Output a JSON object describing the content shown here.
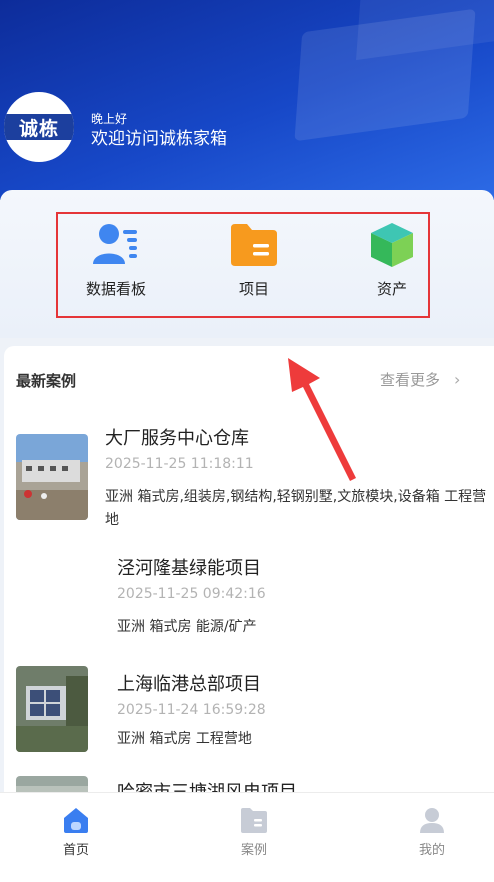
{
  "header": {
    "greeting": "晚上好",
    "welcome": "欢迎访问诚栋家箱",
    "logo_text": "诚栋"
  },
  "quick_actions": [
    {
      "label": "数据看板",
      "icon": "dashboard-user-list-icon"
    },
    {
      "label": "项目",
      "icon": "folder-icon"
    },
    {
      "label": "资产",
      "icon": "cube-icon"
    }
  ],
  "cases_section": {
    "title": "最新案例",
    "see_more": "查看更多",
    "items": [
      {
        "title": "大厂服务中心仓库",
        "time": "2025-11-25 11:18:11",
        "tags": "亚洲 箱式房,组装房,钢结构,轻钢别墅,文旅模块,设备箱 工程营地"
      },
      {
        "title": "泾河隆基绿能项目",
        "time": "2025-11-25 09:42:16",
        "tags": "亚洲 箱式房 能源/矿产"
      },
      {
        "title": "上海临港总部项目",
        "time": "2025-11-24 16:59:28",
        "tags": "亚洲 箱式房 工程营地"
      },
      {
        "title": "哈密市三塘湖风电项目",
        "time": "",
        "tags": ""
      }
    ]
  },
  "tabbar": {
    "items": [
      {
        "label": "首页",
        "active": true
      },
      {
        "label": "案例",
        "active": false
      },
      {
        "label": "我的",
        "active": false
      }
    ]
  },
  "colors": {
    "brand_blue": "#1748c8",
    "highlight_red": "#e53538",
    "folder_orange": "#f79a1e"
  }
}
